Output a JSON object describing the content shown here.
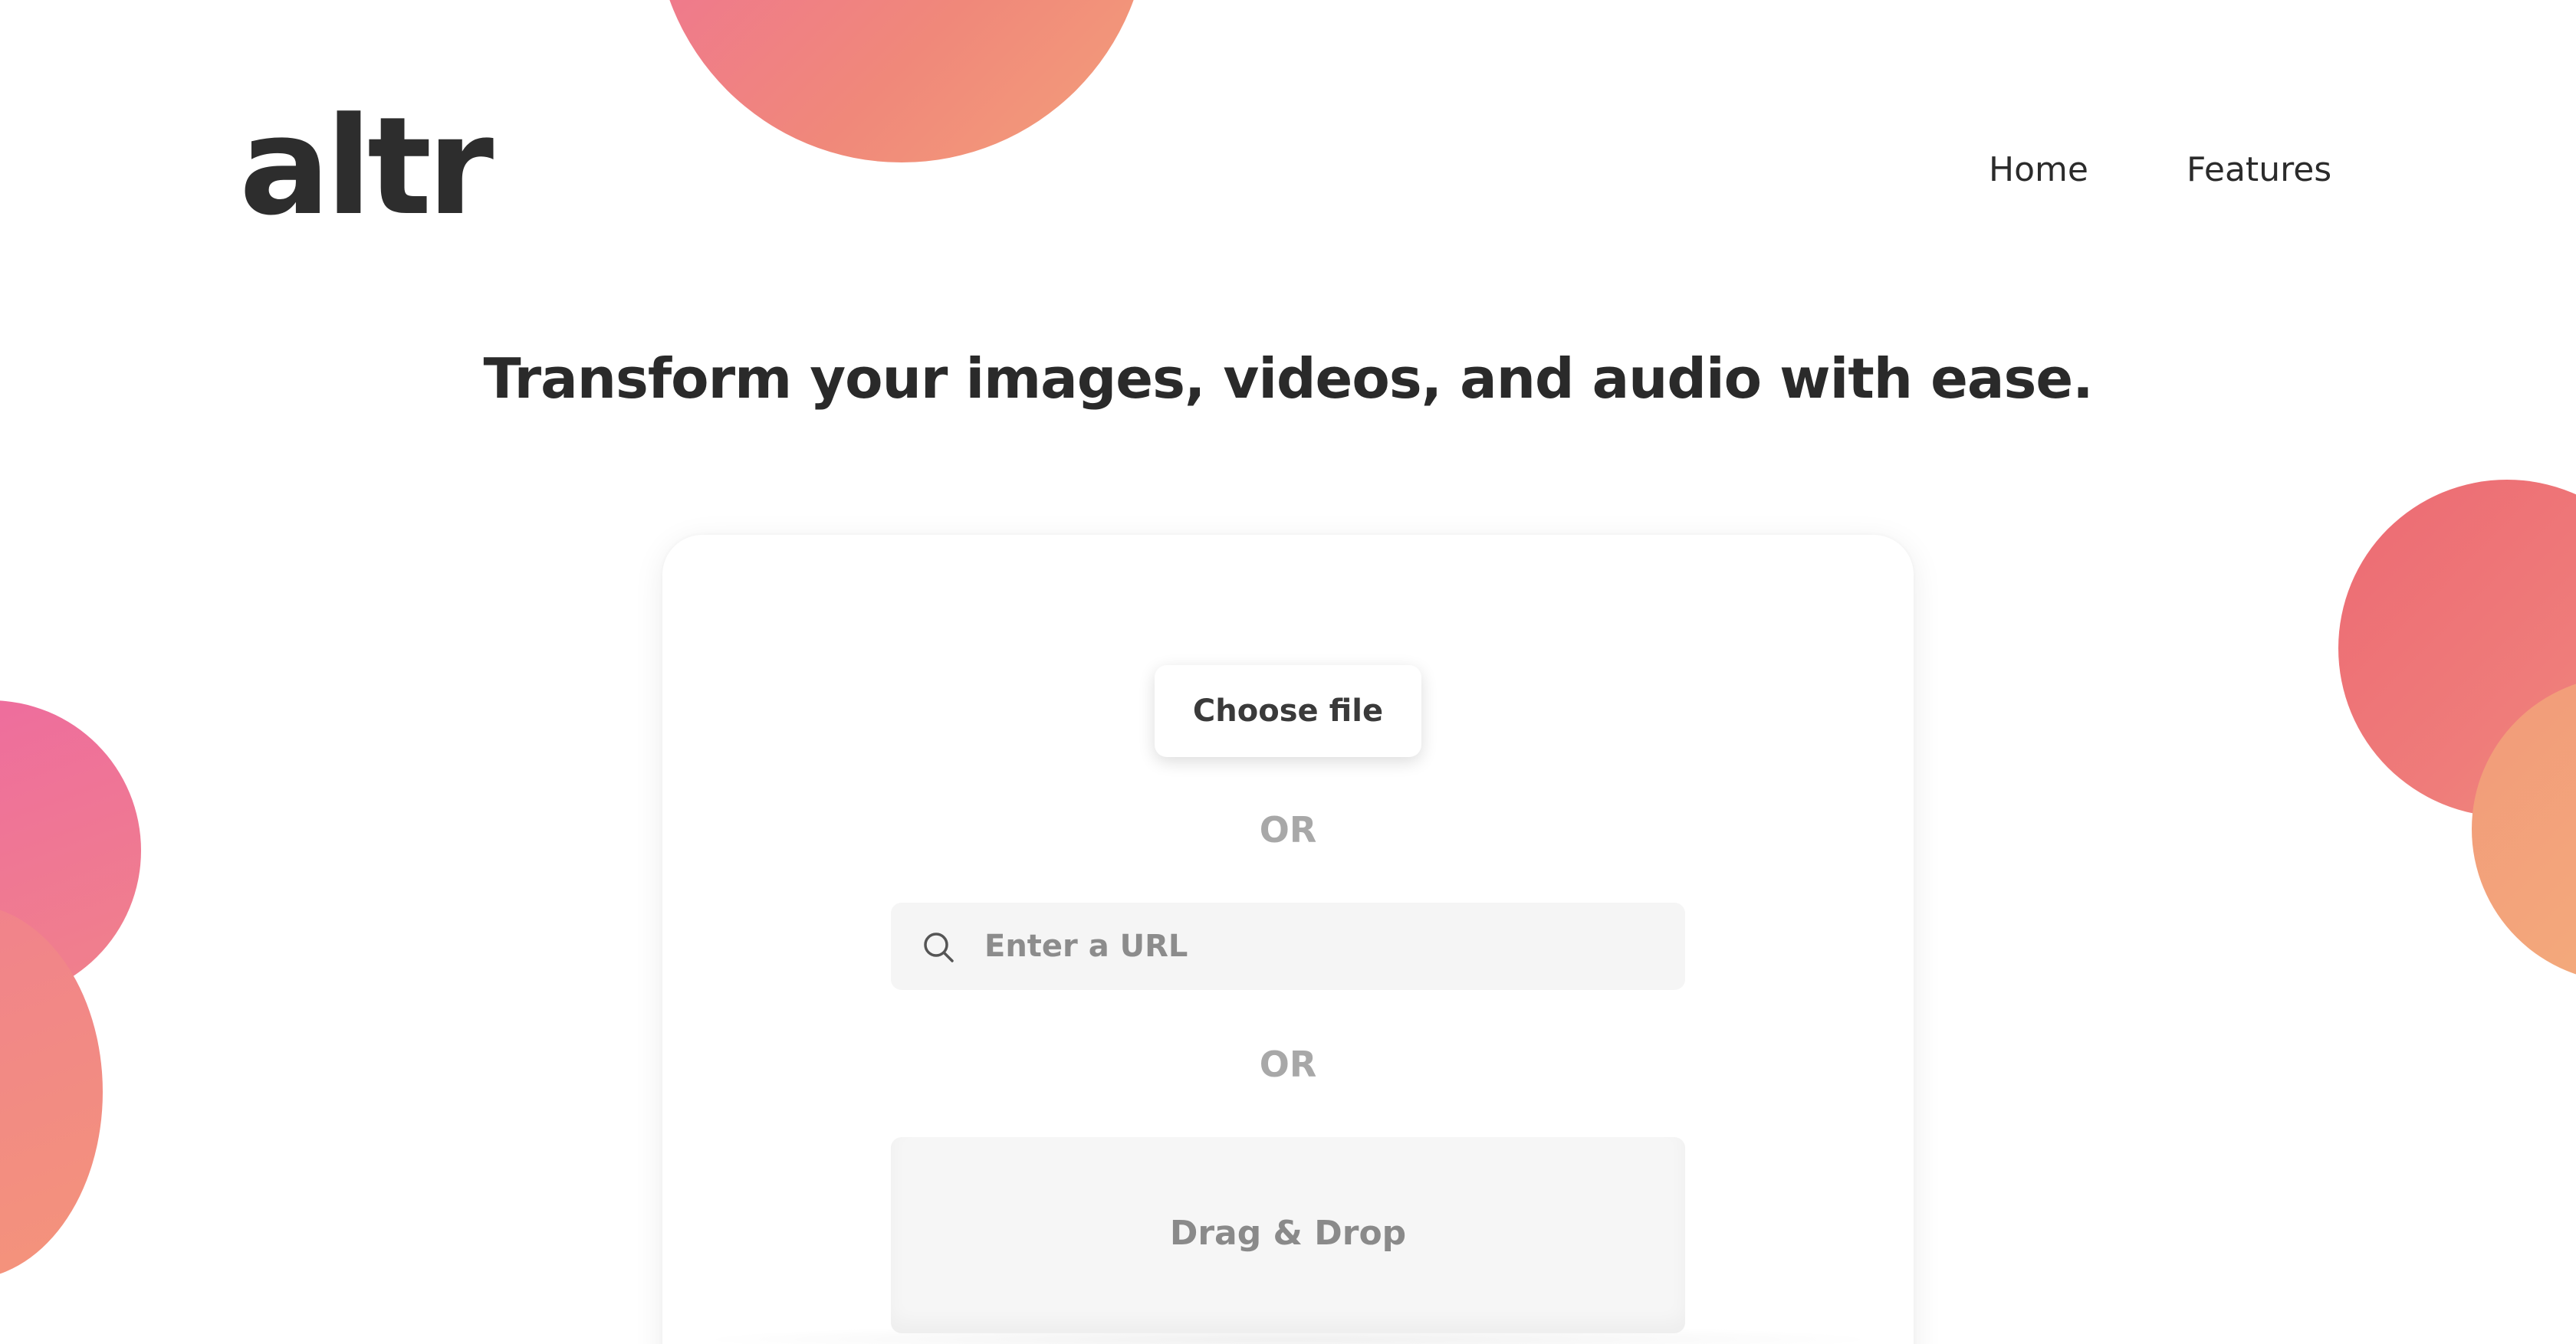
{
  "brand": {
    "logo_text": "altr"
  },
  "nav": {
    "items": [
      {
        "label": "Home"
      },
      {
        "label": "Features"
      }
    ]
  },
  "hero": {
    "headline": "Transform your images, videos, and audio with ease."
  },
  "upload": {
    "choose_file_label": "Choose file",
    "or_label_1": "OR",
    "url_placeholder": "Enter a URL",
    "url_icon": "search-icon",
    "or_label_2": "OR",
    "dropzone_label": "Drag & Drop"
  },
  "colors": {
    "accent_pink": "#ee6aa0",
    "accent_coral": "#f0887a",
    "accent_peach": "#f4b07c",
    "text_dark": "#2b2b2b",
    "muted_gray": "#a8a8a8",
    "field_bg": "#f5f5f5"
  }
}
